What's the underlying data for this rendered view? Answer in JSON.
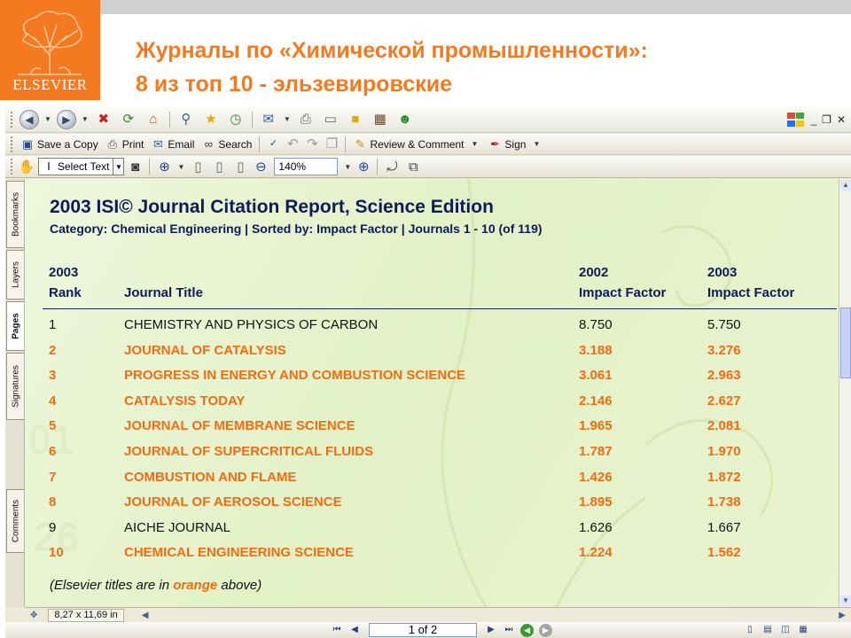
{
  "slide": {
    "logo_text": "ELSEVIER",
    "title_line1": "Журналы по «Химической промышленности»:",
    "title_line2": "8 из топ 10 - эльзевировские",
    "brand_color": "#f47920"
  },
  "toolbar1": {
    "save_copy": "Save a Copy",
    "print": "Print",
    "email": "Email",
    "search": "Search",
    "review": "Review & Comment",
    "sign": "Sign"
  },
  "toolbar2": {
    "select_text": "Select Text",
    "zoom": "140%"
  },
  "side_tabs": {
    "bookmarks": "Bookmarks",
    "layers": "Layers",
    "pages": "Pages",
    "signatures": "Signatures",
    "comments": "Comments"
  },
  "report": {
    "title": "2003 ISI© Journal Citation Report, Science Edition",
    "subtitle": "Category: Chemical Engineering  |  Sorted by: Impact Factor  |  Journals 1 - 10 (of 119)",
    "columns": {
      "rank_line1": "2003",
      "rank_line2": "Rank",
      "title": "Journal Title",
      "if2002_line1": "2002",
      "if2002_line2": "Impact Factor",
      "if2003_line1": "2003",
      "if2003_line2": "Impact Factor"
    },
    "rows": [
      {
        "rank": "1",
        "title": "CHEMISTRY AND PHYSICS OF CARBON",
        "if2002": "8.750",
        "if2003": "5.750",
        "elsevier": false
      },
      {
        "rank": "2",
        "title": "JOURNAL OF CATALYSIS",
        "if2002": "3.188",
        "if2003": "3.276",
        "elsevier": true
      },
      {
        "rank": "3",
        "title": "PROGRESS IN ENERGY AND COMBUSTION SCIENCE",
        "if2002": "3.061",
        "if2003": "2.963",
        "elsevier": true
      },
      {
        "rank": "4",
        "title": "CATALYSIS TODAY",
        "if2002": "2.146",
        "if2003": "2.627",
        "elsevier": true
      },
      {
        "rank": "5",
        "title": "JOURNAL OF MEMBRANE SCIENCE",
        "if2002": "1.965",
        "if2003": "2.081",
        "elsevier": true
      },
      {
        "rank": "6",
        "title": "JOURNAL OF SUPERCRITICAL FLUIDS",
        "if2002": "1.787",
        "if2003": "1.970",
        "elsevier": true
      },
      {
        "rank": "7",
        "title": "COMBUSTION AND FLAME",
        "if2002": "1.426",
        "if2003": "1.872",
        "elsevier": true
      },
      {
        "rank": "8",
        "title": "JOURNAL OF AEROSOL SCIENCE",
        "if2002": "1.895",
        "if2003": "1.738",
        "elsevier": true
      },
      {
        "rank": "9",
        "title": "AICHE JOURNAL",
        "if2002": "1.626",
        "if2003": "1.667",
        "elsevier": false
      },
      {
        "rank": "10",
        "title": "CHEMICAL ENGINEERING SCIENCE",
        "if2002": "1.224",
        "if2003": "1.562",
        "elsevier": true
      }
    ],
    "footnote_before": "(Elsevier titles are in ",
    "footnote_highlight": "orange",
    "footnote_after": " above)",
    "highlight_color": "#f26c12"
  },
  "statusbar": {
    "page_size": "8,27 x 11,69 in"
  },
  "pagenav": {
    "indicator": "1 of 2"
  }
}
